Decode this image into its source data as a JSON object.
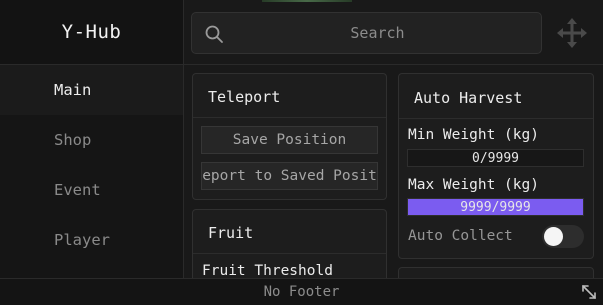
{
  "app": {
    "title": "Y-Hub"
  },
  "search": {
    "placeholder": "Search"
  },
  "sidebar": {
    "items": [
      {
        "label": "Main",
        "active": true
      },
      {
        "label": "Shop"
      },
      {
        "label": "Event"
      },
      {
        "label": "Player"
      }
    ]
  },
  "teleport": {
    "title": "Teleport",
    "save_label": "Save Position",
    "teleport_label": "Teleport to Saved Position"
  },
  "fruit": {
    "title": "Fruit",
    "threshold_label": "Fruit Threshold"
  },
  "auto_harvest": {
    "title": "Auto Harvest",
    "min_weight": {
      "label": "Min Weight (kg)",
      "value_text": "0/9999",
      "fraction": 0
    },
    "max_weight": {
      "label": "Max Weight (kg)",
      "value_text": "9999/9999",
      "fraction": 1
    },
    "auto_collect": {
      "label": "Auto Collect",
      "enabled": false
    }
  },
  "footer": {
    "text": "No Footer"
  },
  "colors": {
    "accent": "#7b5cf0",
    "background": "#191919"
  },
  "icons": {
    "search": "search-icon",
    "move": "move-icon",
    "resize": "resize-icon"
  }
}
